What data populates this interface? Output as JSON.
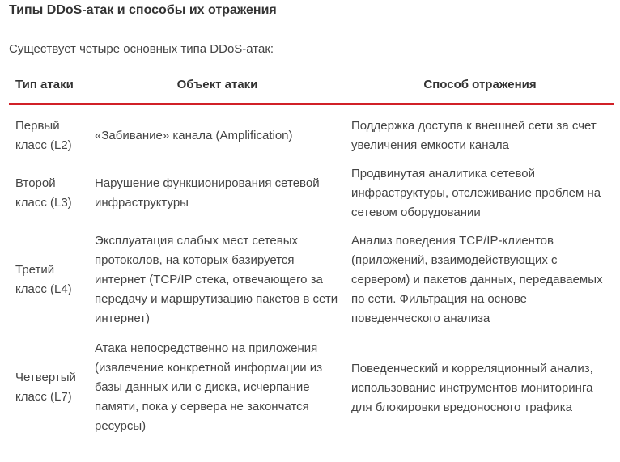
{
  "article": {
    "title": "Типы DDoS-атак и способы их отражения",
    "intro": "Существует четыре основных типа DDoS-атак:"
  },
  "table": {
    "headers": [
      "Тип атаки",
      "Объект атаки",
      "Способ отражения"
    ],
    "accent_color": "#d12027",
    "rows": [
      {
        "type": "Первый класс (L2)",
        "object": "«Забивание» канала (Amplification)",
        "method": "Поддержка доступа к внешней сети за счет увеличения емкости канала"
      },
      {
        "type": "Второй класс (L3)",
        "object": "Нарушение функционирования сетевой инфраструктуры",
        "method": "Продвинутая аналитика сетевой инфраструктуры, отслеживание проблем на сетевом оборудовании"
      },
      {
        "type": "Третий класс (L4)",
        "object": "Эксплуатация слабых мест сетевых протоколов, на которых базируется интернет (TCP/IP стека, отвечающего за передачу и маршрутизацию пакетов в сети интернет)",
        "method": "Анализ поведения TCP/IP-клиентов (приложений, взаимодействующих с сервером) и пакетов данных, передаваемых по сети. Фильтрация на основе поведенческого анализа"
      },
      {
        "type": "Четвертый класс (L7)",
        "object": "Атака непосредственно на приложения (извлечение конкретной информации из базы данных или с диска, исчерпание памяти, пока у сервера не закончатся ресурсы)",
        "method": "Поведенческий и корреляционный анализ, использование инструментов мониторинга для блокировки вредоносного трафика"
      }
    ]
  }
}
